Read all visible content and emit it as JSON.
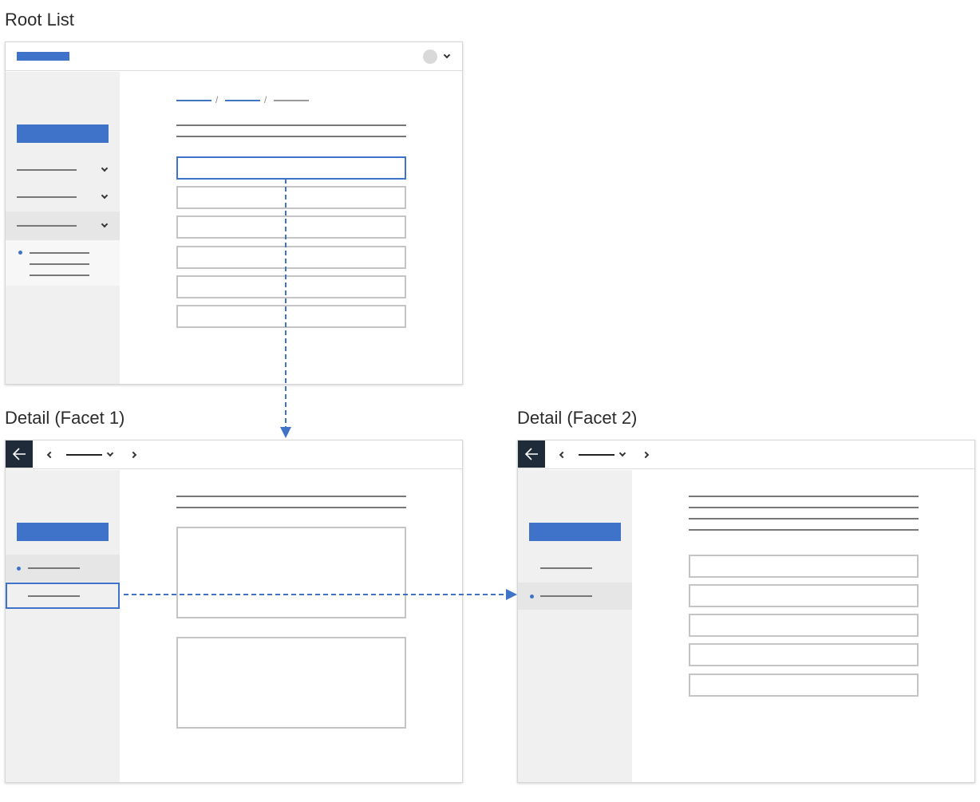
{
  "captions": {
    "root": "Root List",
    "facet1": "Detail (Facet 1)",
    "facet2": "Detail (Facet 2)"
  },
  "breadcrumb_separator": "/",
  "icons": {
    "back": "arrow-left-icon",
    "prev": "chevron-left-icon",
    "next": "chevron-right-icon",
    "dropdown": "chevron-down-icon",
    "avatar": "avatar-icon"
  },
  "colors": {
    "accent": "#3f72c9",
    "back_button": "#1f2b38",
    "sidebar": "#f0f0f0",
    "arrow": "#3f72c9"
  }
}
